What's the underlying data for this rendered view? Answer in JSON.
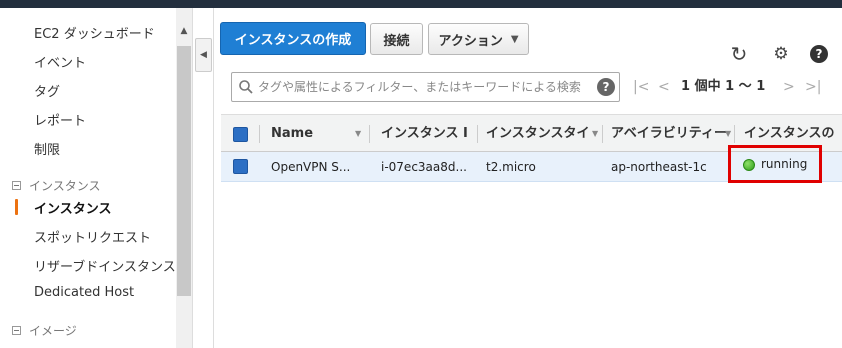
{
  "sidebar": {
    "items": [
      {
        "label": "EC2 ダッシュボード"
      },
      {
        "label": "イベント"
      },
      {
        "label": "タグ"
      },
      {
        "label": "レポート"
      },
      {
        "label": "制限"
      }
    ],
    "section_instances": "インスタンス",
    "instances_items": [
      {
        "label": "インスタンス",
        "active": true
      },
      {
        "label": "スポットリクエスト"
      },
      {
        "label": "リザーブドインスタンス"
      },
      {
        "label": "Dedicated Host"
      }
    ],
    "section_images": "イメージ"
  },
  "toolbar": {
    "create_label": "インスタンスの作成",
    "connect_label": "接続",
    "actions_label": "アクション",
    "actions_caret": "▼"
  },
  "icons": {
    "refresh": "↻",
    "settings": "⚙",
    "help": "?"
  },
  "filter": {
    "placeholder": "タグや属性によるフィルター、またはキーワードによる検索",
    "help": "?"
  },
  "pagination": {
    "first": "|<",
    "prev": "<",
    "text": "1 個中 1 ～ 1",
    "next": ">",
    "last": ">|"
  },
  "table": {
    "columns": [
      {
        "label": "Name"
      },
      {
        "label": "インスタンス I"
      },
      {
        "label": "インスタンスタイ"
      },
      {
        "label": "アベイラビリティー"
      },
      {
        "label": "インスタンスの"
      }
    ],
    "rows": [
      {
        "name": "OpenVPN S...",
        "instance_id": "i-07ec3aa8d...",
        "type": "t2.micro",
        "az": "ap-northeast-1c",
        "state": "running"
      }
    ]
  },
  "colors": {
    "primary": "#1f7fd4",
    "running": "#2f9e1a",
    "highlight": "#e00000",
    "active_bar": "#ec7211"
  }
}
